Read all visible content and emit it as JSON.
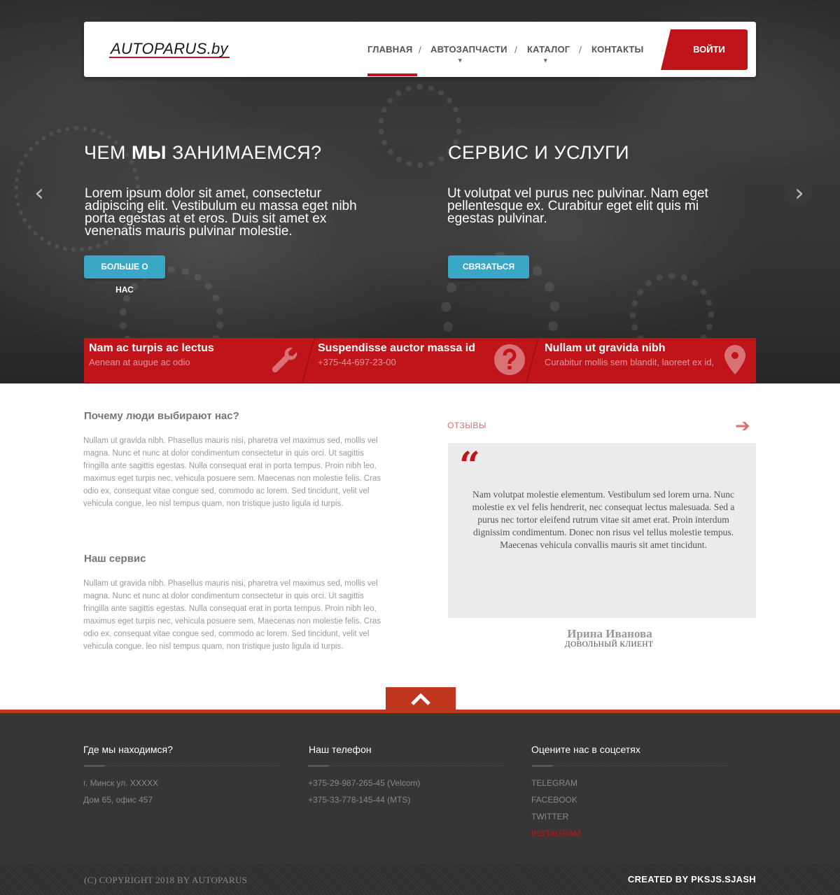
{
  "header": {
    "logo": "AUTOPARUS.by",
    "nav": [
      {
        "label": "ГЛАВНАЯ",
        "active": true,
        "has_dropdown": false
      },
      {
        "label": "АВТОЗАПЧАСТИ",
        "active": false,
        "has_dropdown": true
      },
      {
        "label": "КАТАЛОГ",
        "active": false,
        "has_dropdown": true
      },
      {
        "label": "КОНТАКТЫ",
        "active": false,
        "has_dropdown": false
      }
    ],
    "separator": "/",
    "caret": "▾",
    "login_label": "ВОЙТИ"
  },
  "hero": {
    "left": {
      "title_pre": "ЧЕМ ",
      "title_bold": "МЫ",
      "title_post": " ЗАНИМАЕМСЯ?",
      "text": "Lorem ipsum dolor sit amet, consectetur adipiscing elit. Vestibulum eu massa eget nibh porta egestas at et eros. Duis sit amet ex venenatis mauris pulvinar molestie.",
      "button": "БОЛЬШЕ О НАС"
    },
    "right": {
      "title": "СЕРВИС  И  УСЛУГИ",
      "text": "Ut volutpat vel purus nec pulvinar. Nam eget pellentesque ex. Curabitur eget elit quis mi egestas pulvinar.",
      "button": "СВЯЗАТЬСЯ"
    },
    "prev_arrow": "‹",
    "next_arrow": "›"
  },
  "features": [
    {
      "title": "Nam ac turpis ac lectus",
      "subtitle": "Aenean at augue ac odio",
      "icon": "wrench-icon"
    },
    {
      "title": "Suspendisse auctor massa id",
      "subtitle": "+375-44-697-23-00",
      "icon": "question-icon"
    },
    {
      "title": "Nullam ut gravida nibh",
      "subtitle": "Curabitur mollis sem blandit, laoreet ex id,",
      "icon": "map-pin-icon"
    }
  ],
  "content": {
    "why_title": "Почему люди выбирают нас?",
    "why_text": "Nullam ut gravida nibh. Phasellus mauris nisi, pharetra vel maximus sed, mollis vel magna. Nunc et nunc at dolor condimentum consectetur in quis orci. Ut sagittis fringilla ante sagittis egestas. Nulla consequat erat in porta tempus. Proin nibh leo, maximus eget turpis nec, vehicula posuere sem. Maecenas non molestie felis. Cras odio ex, consequat vitae congue sed, commodo ac lorem. Sed tincidunt, velit vel vehicula congue, leo nisl tempus quam, non tristique justo ligula id turpis.",
    "service_title": "Наш сервис",
    "service_text": "Nullam ut gravida nibh. Phasellus mauris nisi, pharetra vel maximus sed, mollis vel magna. Nunc et nunc at dolor condimentum consectetur in quis orci. Ut sagittis fringilla ante sagittis egestas. Nulla consequat erat in porta tempus. Proin nibh leo, maximus eget turpis nec, vehicula posuere sem. Maecenas non molestie felis. Cras odio ex, consequat vitae congue sed, commodo ac lorem. Sed tincidunt, velit vel vehicula congue, leo nisl tempus quam, non tristique justo ligula id turpis."
  },
  "reviews": {
    "label": "ОТЗЫВЫ",
    "arrow": "➔",
    "quote_mark": "“",
    "text": "Nam volutpat molestie elementum. Vestibulum sed lorem urna. Nunc molestie ex vel felis hendrerit, nec consequat lectus malesuada. Sed a purus nec tortor eleifend rutrum vitae sit amet erat. Proin interdum dignissim condimentum. Donec non risus vel tellus molestie tempus. Maecenas vehicula convallis mauris sit amet tincidunt.",
    "author": "Ирина Иванова",
    "role": "ДОВОЛЬНЫЙ КЛИЕНТ"
  },
  "footer": {
    "location": {
      "title": "Где мы находимся?",
      "lines": [
        "г. Минск ул. XXXXX",
        "Дом 65, офис 457"
      ]
    },
    "phone": {
      "title": "Наш телефон",
      "lines": [
        "+375-29-987-265-45 (Velcom)",
        "+375-33-778-145-44 (MTS)"
      ]
    },
    "social": {
      "title": "Оцените нас в соцсетях",
      "links": [
        "TELEGRAM",
        "FACEBOOK",
        "TWITTER",
        "INSTAGRAM"
      ],
      "highlighted": "INSTAGRAM"
    },
    "copyright": "(C) COPYRIGHT 2018 BY AUTOPARUS",
    "created_by": "CREATED BY PKSJS.SJASH"
  },
  "colors": {
    "accent": "#c0141b",
    "button_blue": "#38a8c4",
    "footer_bg": "#363636",
    "footer_accent": "#c0371f"
  }
}
